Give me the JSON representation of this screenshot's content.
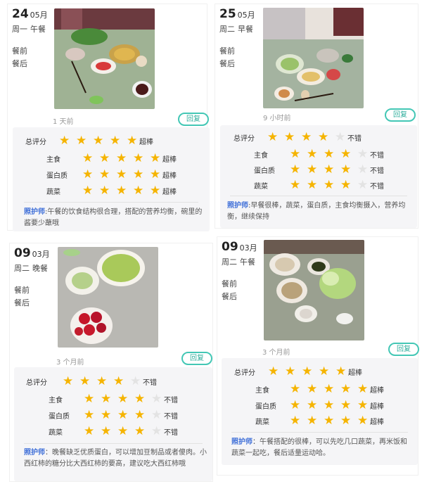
{
  "colors": {
    "accent": "#43c7b5",
    "star": "#f5b400",
    "star_off": "#e3e3e3",
    "nurse_label": "#3f6fd8"
  },
  "icons": {
    "star": "star-icon"
  },
  "cards": [
    {
      "day": "24",
      "month": "05月",
      "weekday": "周一",
      "meal": "午餐",
      "before": "餐前",
      "after": "餐后",
      "time_ago": "1 天前",
      "reply": "回复",
      "overall_label": "总评分",
      "overall_stars": 5,
      "overall_text": "超棒",
      "items": [
        {
          "label": "主食",
          "stars": 5,
          "text": "超棒"
        },
        {
          "label": "蛋白质",
          "stars": 5,
          "text": "超棒"
        },
        {
          "label": "蔬菜",
          "stars": 5,
          "text": "超棒"
        }
      ],
      "nurse": "照护师",
      "comment": ":午餐的饮食结构很合理，搭配的营养均衡，碗里的酱要少蘸哦"
    },
    {
      "day": "25",
      "month": "05月",
      "weekday": "周二",
      "meal": "早餐",
      "before": "餐前",
      "after": "餐后",
      "time_ago": "9 小时前",
      "reply": "回复",
      "overall_label": "总评分",
      "overall_stars": 4,
      "overall_text": "不错",
      "items": [
        {
          "label": "主食",
          "stars": 4,
          "text": "不错"
        },
        {
          "label": "蛋白质",
          "stars": 4,
          "text": "不错"
        },
        {
          "label": "蔬菜",
          "stars": 4,
          "text": "不错"
        }
      ],
      "nurse": "照护师",
      "comment": ":早餐很棒，蔬菜，蛋白质，主食均衡摄入，营养均衡，继续保持"
    },
    {
      "day": "09",
      "month": "03月",
      "weekday": "周二",
      "meal": "晚餐",
      "before": "餐前",
      "after": "餐后",
      "time_ago": "3 个月前",
      "reply": "回复",
      "overall_label": "总评分",
      "overall_stars": 4,
      "overall_text": "不错",
      "items": [
        {
          "label": "主食",
          "stars": 4,
          "text": "不错"
        },
        {
          "label": "蛋白质",
          "stars": 4,
          "text": "不错"
        },
        {
          "label": "蔬菜",
          "stars": 4,
          "text": "不错"
        }
      ],
      "nurse": "照护师",
      "comment": "：晚餐缺乏优质蛋白，可以增加豆制品或者傻肉。小西红柿的糖分比大西红柿的要高，建议吃大西红柿哦"
    },
    {
      "day": "09",
      "month": "03月",
      "weekday": "周二",
      "meal": "午餐",
      "before": "餐前",
      "after": "餐后",
      "time_ago": "3 个月前",
      "reply": "回复",
      "overall_label": "总评分",
      "overall_stars": 5,
      "overall_text": "超棒",
      "items": [
        {
          "label": "主食",
          "stars": 5,
          "text": "超棒"
        },
        {
          "label": "蛋白质",
          "stars": 5,
          "text": "超棒"
        },
        {
          "label": "蔬菜",
          "stars": 5,
          "text": "超棒"
        }
      ],
      "nurse": "照护师",
      "comment": "：午餐搭配的很棒，可以先吃几口蔬菜，再米饭和蔬菜一起吃，餐后适量运动哈。"
    }
  ]
}
